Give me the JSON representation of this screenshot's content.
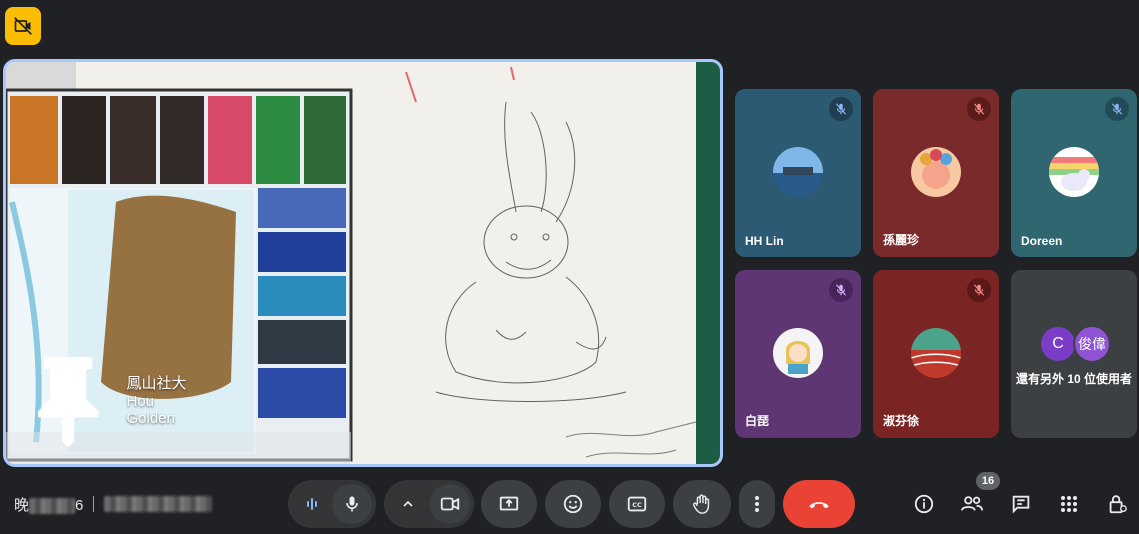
{
  "presenter": {
    "name": "鳳山社大Hou Golden"
  },
  "participants": [
    {
      "name": "HH Lin",
      "muted": true,
      "bg": "#2c5a72",
      "mute_bg": "#1f3f50"
    },
    {
      "name": "孫麗珍",
      "muted": true,
      "bg": "#7a2a2a",
      "mute_bg": "#5a1b1b"
    },
    {
      "name": "Doreen",
      "muted": true,
      "bg": "#2f6670",
      "mute_bg": "#224c55"
    },
    {
      "name": "白琵",
      "muted": true,
      "bg": "#5e3674",
      "mute_bg": "#47245a"
    },
    {
      "name": "淑芬徐",
      "muted": true,
      "bg": "#7a2424",
      "mute_bg": "#5a1818"
    }
  ],
  "more_participants": {
    "avatar1": "C",
    "avatar2": "俊偉",
    "label": "還有另外 10 位使用者"
  },
  "meeting": {
    "time_prefix": "晚",
    "time_suffix": "6"
  },
  "controls": {
    "participant_count": "16"
  },
  "colors": {
    "accent_border": "#a8c7fa",
    "leave_red": "#ea4335",
    "badge_yellow": "#fbbc04"
  }
}
